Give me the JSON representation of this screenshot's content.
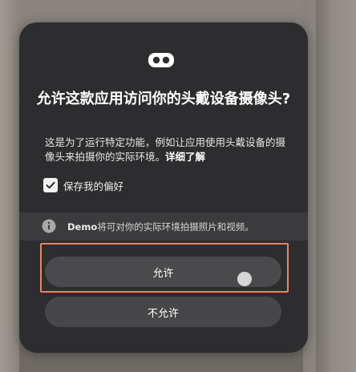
{
  "dialog": {
    "title": "允许这款应用访问你的头戴设备摄像头?",
    "description": "这是为了运行特定功能，例如让应用使用头戴设备的摄像头来拍摄你的实际环境。",
    "learn_more": "详细了解",
    "checkbox": {
      "label": "保存我的偏好",
      "checked": true
    },
    "info": {
      "app_name": "Demo",
      "text": "将可对你的实际环境拍摄照片和视频。"
    },
    "allow_label": "允许",
    "deny_label": "不允许"
  },
  "icons": {
    "header": "vr-headset-icon",
    "checkbox": "checkmark-icon",
    "info": "info-icon"
  },
  "colors": {
    "dialog_bg": "#2d2d2f",
    "button_bg": "#474749",
    "highlight": "#e8855e"
  }
}
